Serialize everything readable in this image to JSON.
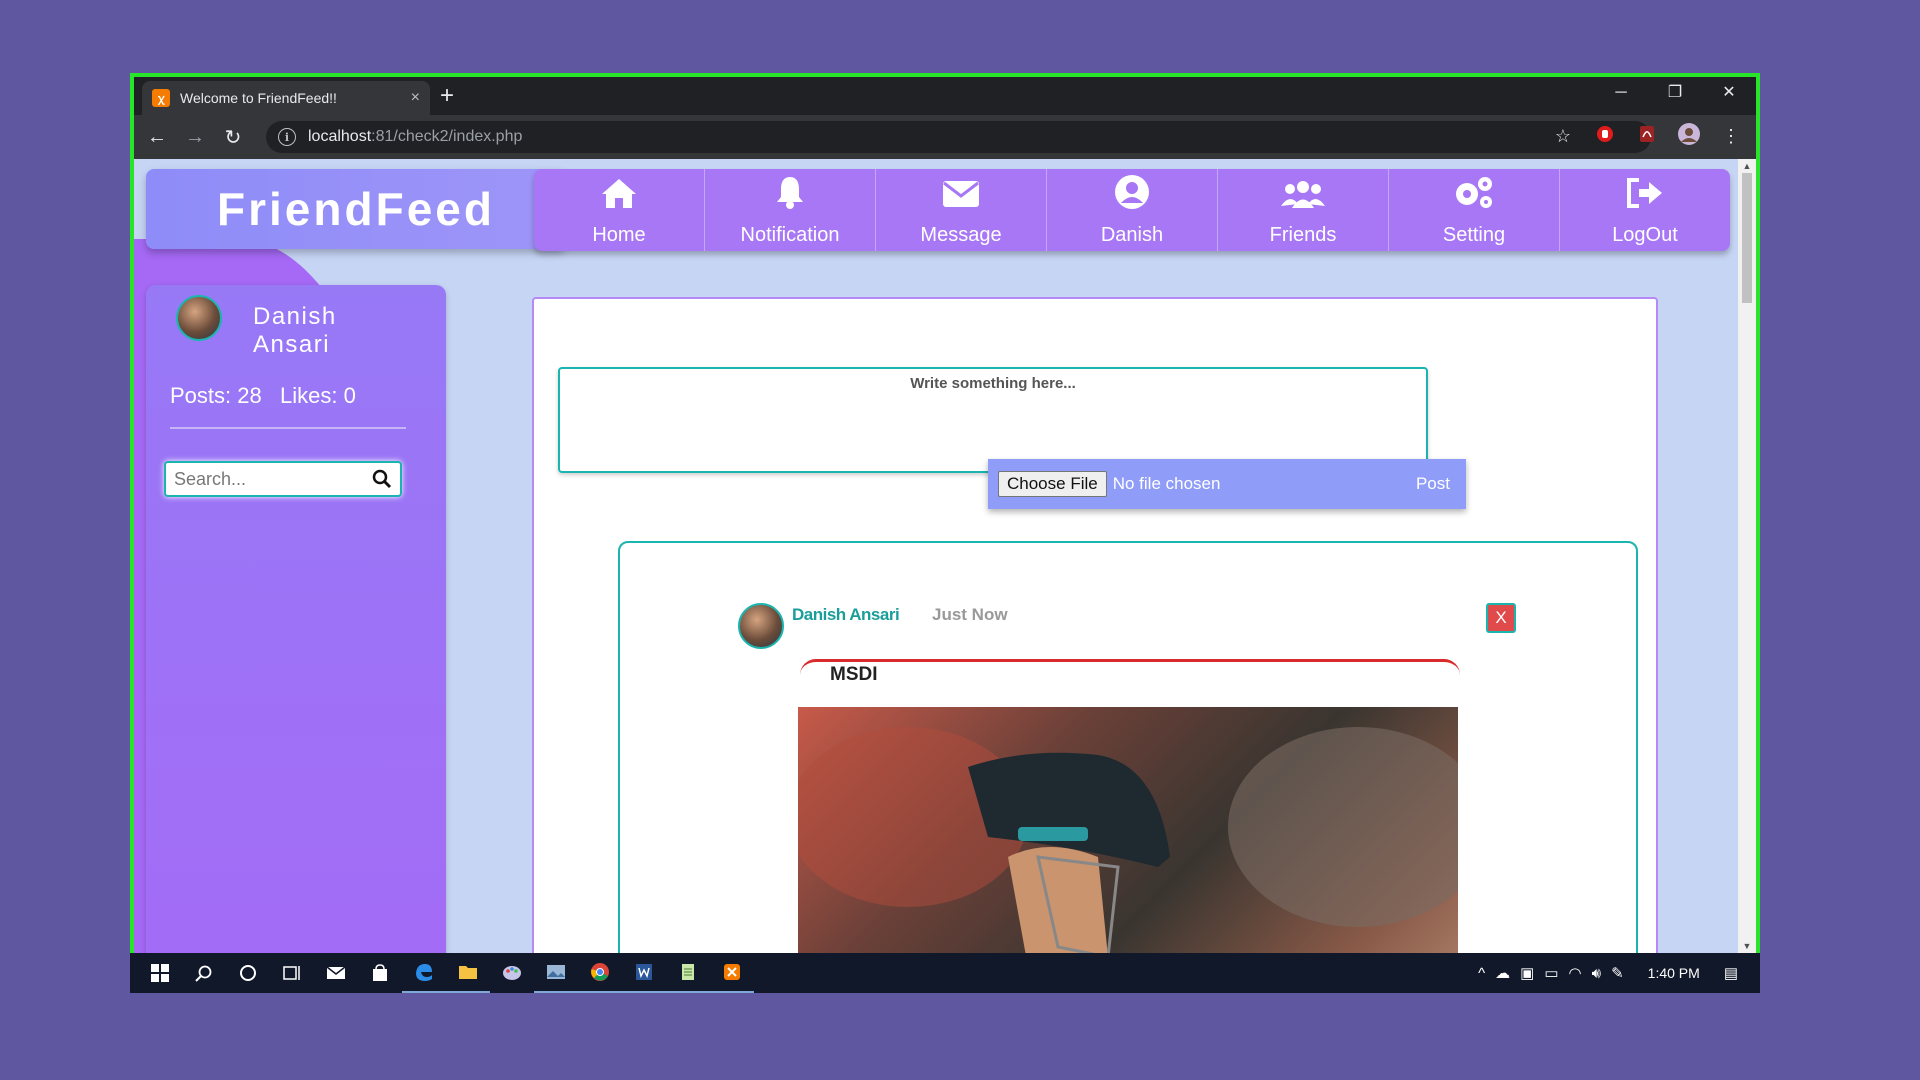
{
  "browser": {
    "tab_title": "Welcome to FriendFeed!!",
    "tab_close": "×",
    "new_tab": "+",
    "url_host": "localhost",
    "url_path": ":81/check2/index.php",
    "window_controls": {
      "minimize": "─",
      "restore": "❐",
      "close": "✕"
    }
  },
  "site": {
    "logo": "FriendFeed",
    "nav": [
      {
        "label": "Home",
        "icon": "home-icon"
      },
      {
        "label": "Notification",
        "icon": "bell-icon"
      },
      {
        "label": "Message",
        "icon": "envelope-icon"
      },
      {
        "label": "Danish",
        "icon": "user-circle-icon"
      },
      {
        "label": "Friends",
        "icon": "users-icon"
      },
      {
        "label": "Setting",
        "icon": "gears-icon"
      },
      {
        "label": "LogOut",
        "icon": "sign-out-icon"
      }
    ]
  },
  "sidebar": {
    "name": "Danish Ansari",
    "stats": "Posts: 28   Likes: 0",
    "search_placeholder": "Search..."
  },
  "compose": {
    "placeholder": "Write something here...",
    "choose_file": "Choose File",
    "no_file": "No file chosen",
    "post": "Post"
  },
  "post": {
    "author": "Danish Ansari",
    "time": "Just Now",
    "close": "X",
    "text": "MSDI"
  },
  "taskbar": {
    "time": "1:40 PM"
  },
  "colors": {
    "background": "#5f579f",
    "frame_border": "#28e52a",
    "navbar": "#a777f6",
    "teal": "#1bb5b0",
    "content_bg": "#c7d5f5"
  }
}
